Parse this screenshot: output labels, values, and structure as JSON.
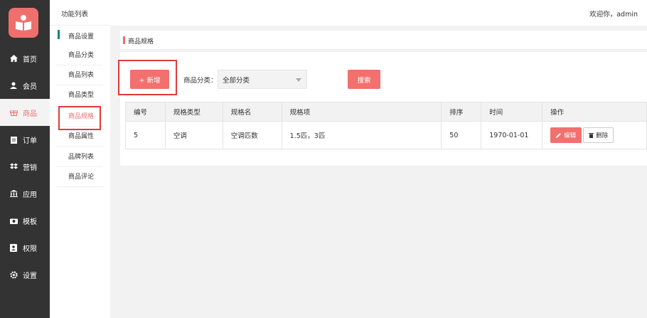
{
  "sidebar": {
    "items": [
      {
        "label": "首页",
        "icon": "home-icon"
      },
      {
        "label": "会员",
        "icon": "user-icon"
      },
      {
        "label": "商品",
        "icon": "gift-icon"
      },
      {
        "label": "订单",
        "icon": "clipboard-icon"
      },
      {
        "label": "营销",
        "icon": "dropbox-icon"
      },
      {
        "label": "应用",
        "icon": "bank-icon"
      },
      {
        "label": "模板",
        "icon": "camera-icon"
      },
      {
        "label": "权限",
        "icon": "id-card-icon"
      },
      {
        "label": "设置",
        "icon": "gear-icon"
      }
    ],
    "active_index": 2
  },
  "subnav": {
    "header": "功能列表",
    "group_title": "商品设置",
    "items": [
      "商品分类",
      "商品列表",
      "商品类型",
      "商品规格",
      "商品属性",
      "品牌列表",
      "商品评论"
    ],
    "active_index": 3
  },
  "topbar": {
    "welcome": "欢迎你，admin"
  },
  "panel": {
    "title": "商品规格",
    "add_label": "+ 新增",
    "category_label": "商品分类：",
    "category_value": "全部分类",
    "search_label": "搜索"
  },
  "table": {
    "headers": [
      "编号",
      "规格类型",
      "规格名",
      "规格项",
      "排序",
      "时间",
      "操作"
    ],
    "rows": [
      {
        "id": "5",
        "type": "空调",
        "name": "空调匹数",
        "items": "1.5匹，3匹",
        "sort": "50",
        "time": "1970-01-01",
        "edit": "编辑",
        "delete": "删除"
      }
    ]
  },
  "colors": {
    "accent": "#f2706e",
    "sidebar_bg": "#333333",
    "group_marker": "#0b8b73",
    "highlight_box": "#e03a3a"
  }
}
